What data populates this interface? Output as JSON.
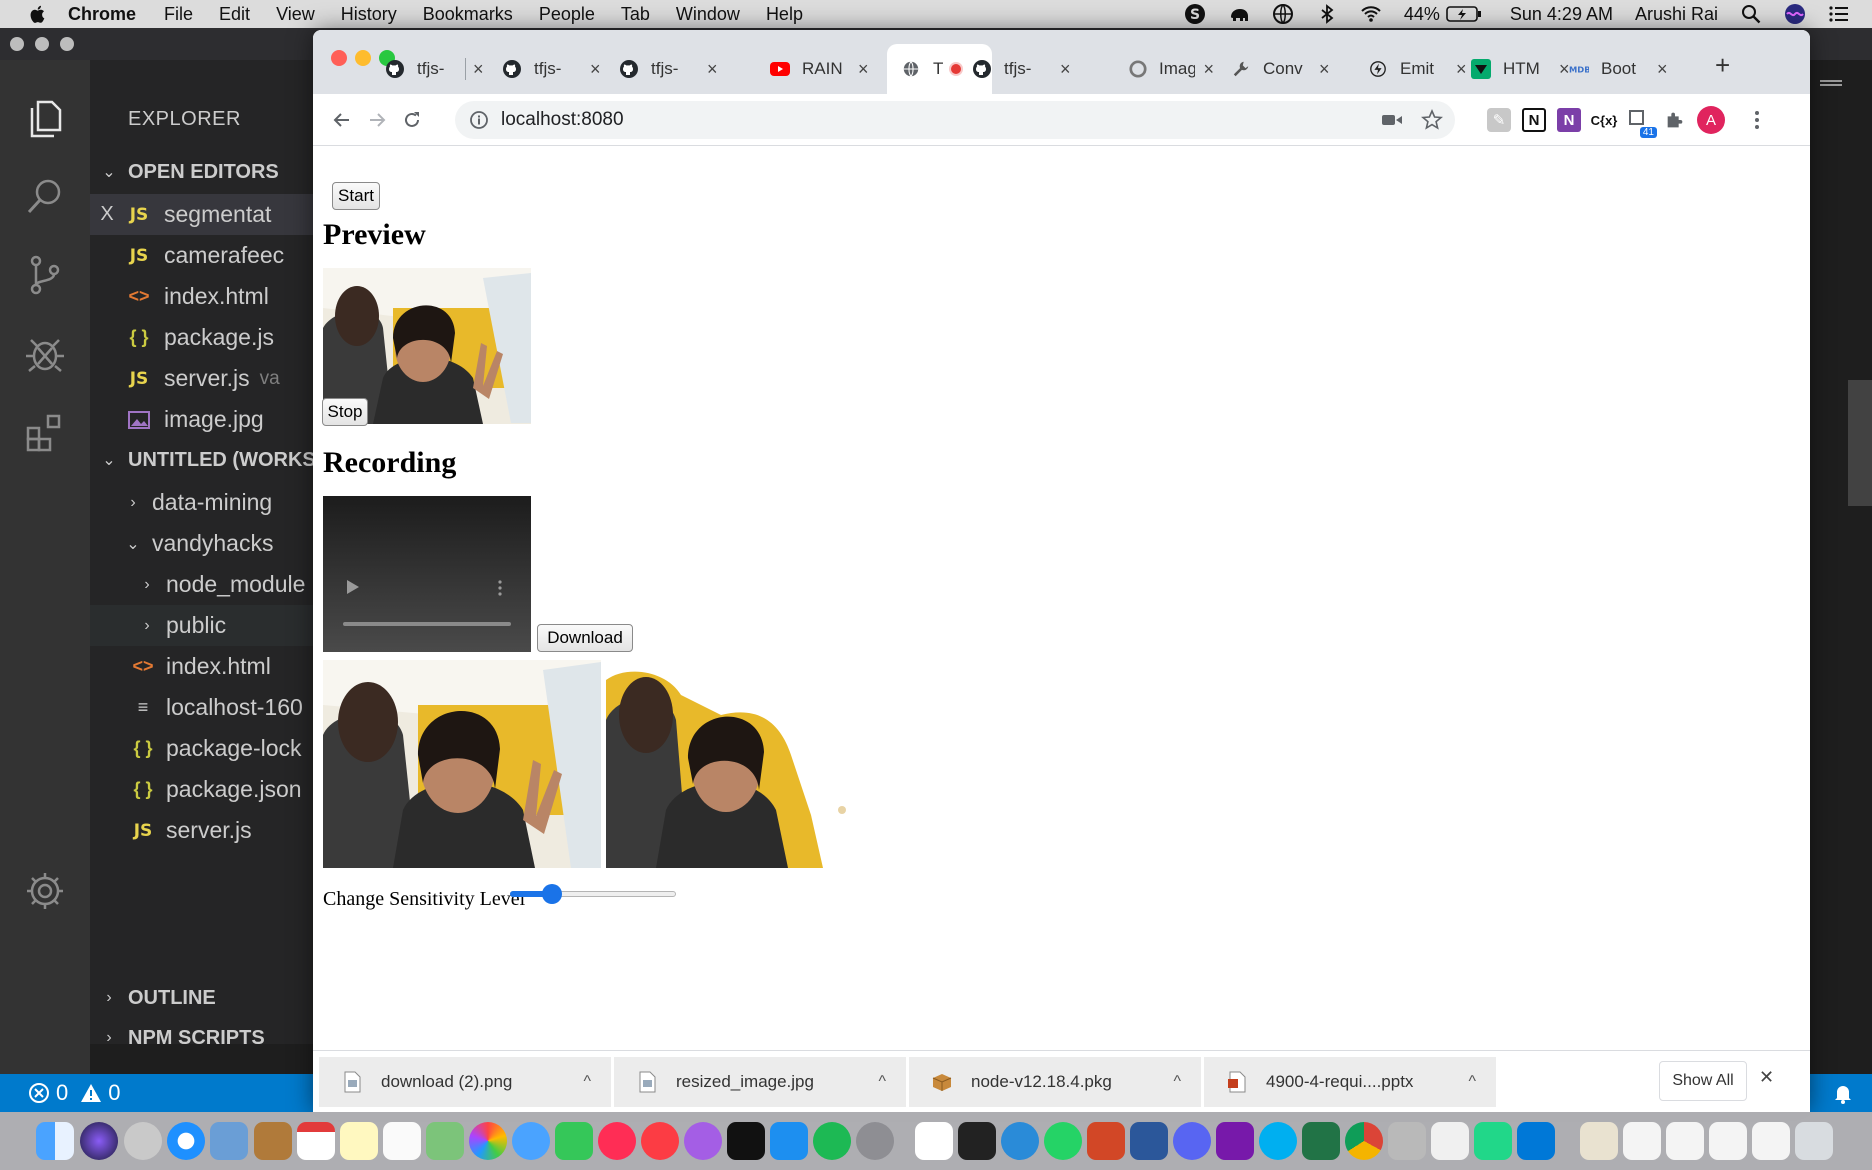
{
  "menubar": {
    "app": "Chrome",
    "items": [
      "File",
      "Edit",
      "View",
      "History",
      "Bookmarks",
      "People",
      "Tab",
      "Window",
      "Help"
    ],
    "battery": "44%",
    "clock": "Sun 4:29 AM",
    "user": "Arushi Rai"
  },
  "vscode": {
    "explorer_title": "EXPLORER",
    "open_editors_label": "OPEN EDITORS",
    "open_editors": [
      {
        "icon": "js",
        "name": "segmentat",
        "close": "X"
      },
      {
        "icon": "js",
        "name": "camerafeec"
      },
      {
        "icon": "html",
        "name": "index.html"
      },
      {
        "icon": "json",
        "name": "package.js"
      },
      {
        "icon": "js",
        "name": "server.js",
        "extra": "va"
      },
      {
        "icon": "img",
        "name": "image.jpg"
      }
    ],
    "workspace_label": "UNTITLED (WORKS",
    "tree": [
      {
        "chev": ">",
        "name": "data-mining"
      },
      {
        "chev": "v",
        "name": "vandyhacks"
      },
      {
        "chev": ">",
        "name": "node_module"
      },
      {
        "chev": ">",
        "name": "public"
      },
      {
        "icon": "html",
        "name": "index.html"
      },
      {
        "icon": "txt",
        "name": "localhost-160"
      },
      {
        "icon": "json",
        "name": "package-lock"
      },
      {
        "icon": "json",
        "name": "package.json"
      },
      {
        "icon": "js",
        "name": "server.js"
      }
    ],
    "outline_label": "OUTLINE",
    "npm_label": "NPM SCRIPTS",
    "status_errors": "0",
    "status_warnings": "0",
    "icon_js": "JS",
    "icon_html": "<>",
    "icon_json": "{ }"
  },
  "chrome": {
    "tabs": [
      {
        "title": "tfjs-",
        "favicon": "github-icon"
      },
      {
        "title": "tfjs-",
        "favicon": "github-icon"
      },
      {
        "title": "tfjs-",
        "favicon": "github-icon"
      },
      {
        "title": "RAIN",
        "favicon": "youtube-icon"
      },
      {
        "title": "T",
        "favicon": "globe-icon",
        "active": true
      },
      {
        "title": "tfjs-",
        "favicon": "github-icon"
      },
      {
        "title": "Imag",
        "favicon": "circle-icon"
      },
      {
        "title": "Conv",
        "favicon": "wrench-icon"
      },
      {
        "title": "Emit",
        "favicon": "bolt-icon"
      },
      {
        "title": "HTM",
        "favicon": "w3-icon"
      },
      {
        "title": "Boot",
        "favicon": "mdb-icon"
      }
    ],
    "tab_close": "×",
    "new_tab": "+",
    "url": "localhost:8080",
    "extension_badge": "41",
    "profile_initial": "A",
    "ext_notion": "N",
    "ext_cx": "C{x}"
  },
  "page": {
    "start_label": "Start",
    "preview_heading": "Preview",
    "stop_label": "Stop",
    "recording_heading": "Recording",
    "download_label": "Download",
    "sensitivity_label": "Change Sensitivity Level",
    "sensitivity_value": 0.22
  },
  "downloads": {
    "items": [
      "download (2).png",
      "resized_image.jpg",
      "node-v12.18.4.pkg",
      "4900-4-requi....pptx"
    ],
    "show_all": "Show All",
    "close": "✕",
    "expand_glyph": "^"
  },
  "colors": {
    "vscode_blue": "#007acc",
    "chrome_tab_bg": "#dee1e6",
    "youtube_red": "#ff0000"
  }
}
